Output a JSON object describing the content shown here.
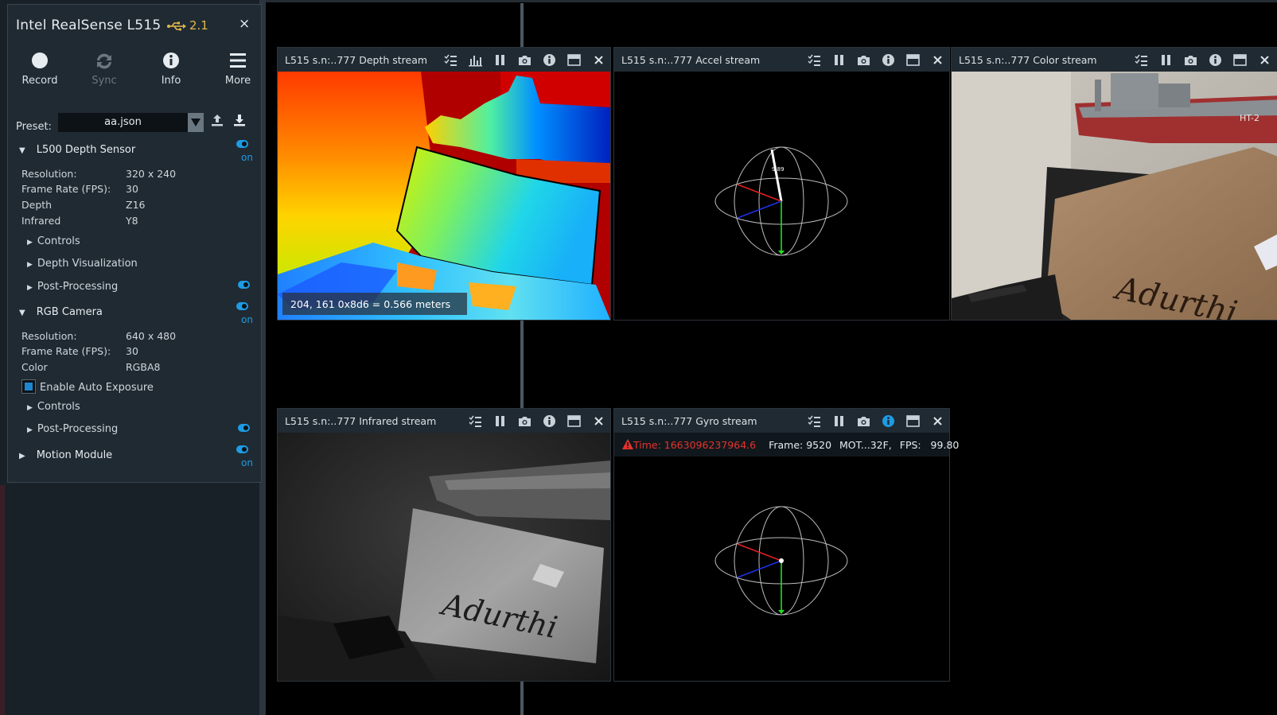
{
  "device": {
    "title": "Intel RealSense L515",
    "usb_version": "2.1",
    "close": "×"
  },
  "toolbar": {
    "record": "Record",
    "sync": "Sync",
    "info": "Info",
    "more": "More"
  },
  "preset": {
    "label": "Preset:",
    "value": "aa.json"
  },
  "depth_sensor": {
    "name": "L500 Depth Sensor",
    "toggle": "on",
    "props": [
      {
        "k": "Resolution:",
        "v": "320 x 240"
      },
      {
        "k": "Frame Rate (FPS):",
        "v": "30"
      },
      {
        "k": "Depth",
        "v": "Z16"
      },
      {
        "k": "Infrared",
        "v": "Y8"
      }
    ],
    "controls": "Controls",
    "depth_vis": "Depth Visualization",
    "post": "Post-Processing"
  },
  "rgb_camera": {
    "name": "RGB Camera",
    "toggle": "on",
    "props": [
      {
        "k": "Resolution:",
        "v": "640 x 480"
      },
      {
        "k": "Frame Rate (FPS):",
        "v": "30"
      },
      {
        "k": "Color",
        "v": "RGBA8"
      }
    ],
    "auto_exposure": "Enable Auto Exposure",
    "controls": "Controls",
    "post": "Post-Processing"
  },
  "motion_module": {
    "name": "Motion Module",
    "toggle": "on"
  },
  "streams": {
    "depth": {
      "title": "L515 s.n:..777 Depth stream",
      "readout": "204, 161 0x8d6 = 0.566 meters"
    },
    "accel": {
      "title": "L515 s.n:..777 Accel stream",
      "vector_label": "9.89"
    },
    "color": {
      "title": "L515 s.n:..777 Color stream",
      "scene_text": "Adurthi",
      "ship_text": "HT-2"
    },
    "infrared": {
      "title": "L515 s.n:..777 Infrared stream",
      "scene_text": "Adurthi"
    },
    "gyro": {
      "title": "L515 s.n:..777 Gyro stream",
      "time": "Time: 1663096237964.6",
      "frame": "Frame: 9520",
      "mot": "MOT...32F,",
      "fps": "FPS:   99.80"
    }
  },
  "colors": {
    "accent": "#1e9be4",
    "panel": "#202a32",
    "warning": "#e6322c",
    "usb": "#e2b84a"
  }
}
